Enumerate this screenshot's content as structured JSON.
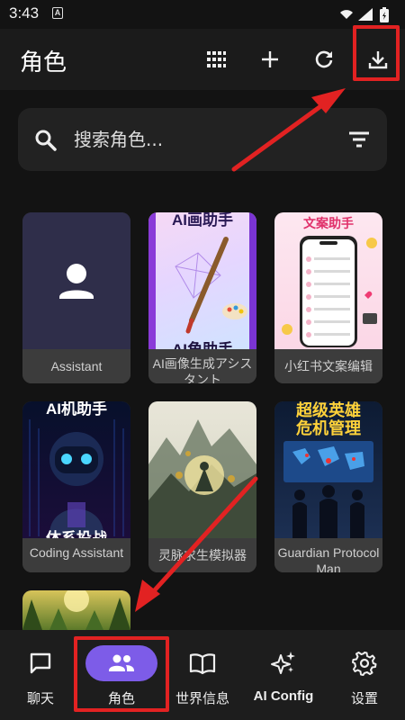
{
  "status_bar": {
    "time": "3:43",
    "notif_glyph": "A"
  },
  "app_bar": {
    "title": "角色",
    "actions": [
      "grid-icon",
      "add-icon",
      "refresh-icon",
      "download-icon"
    ]
  },
  "search": {
    "placeholder": "搜索角色..."
  },
  "cards": [
    {
      "label": "Assistant"
    },
    {
      "label": "AI画像生成アシスタント",
      "thumb_title_top": "AI画助手",
      "thumb_title_bottom": "AI角助手"
    },
    {
      "label": "小红书文案编辑",
      "thumb_title_top": "文案助手"
    },
    {
      "label": "Coding Assistant",
      "thumb_title_top": "AI机助手",
      "thumb_title_bottom": "体系投战"
    },
    {
      "label": "灵脉求生模拟器"
    },
    {
      "label": "Guardian Protocol Man",
      "thumb_title_top": "超级英雄",
      "thumb_title_top2": "危机管理"
    },
    {
      "label": ""
    }
  ],
  "nav": {
    "items": [
      {
        "label": "聊天",
        "icon": "chat-icon"
      },
      {
        "label": "角色",
        "icon": "people-icon",
        "active": true
      },
      {
        "label": "世界信息",
        "icon": "book-icon"
      },
      {
        "label": "AI Config",
        "icon": "sparkles-icon"
      },
      {
        "label": "设置",
        "icon": "gear-icon"
      }
    ]
  },
  "colors": {
    "background": "#131313",
    "accent": "#7d5ce8",
    "annotation_red": "#e22222"
  }
}
